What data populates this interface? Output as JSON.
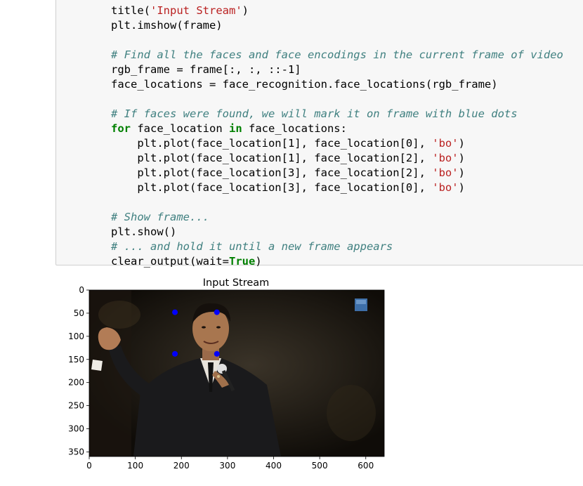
{
  "code_cell": {
    "lines": [
      [
        {
          "t": "title(",
          "c": ""
        },
        {
          "t": "'Input Stream'",
          "c": "st"
        },
        {
          "t": ")",
          "c": ""
        }
      ],
      [
        {
          "t": "plt.imshow(frame)",
          "c": ""
        }
      ],
      [],
      [
        {
          "t": "# Find all the faces and face encodings in the current frame of video",
          "c": "cm"
        }
      ],
      [
        {
          "t": "rgb_frame = frame[:, :, ::-1]",
          "c": ""
        }
      ],
      [
        {
          "t": "face_locations = face_recognition.face_locations(rgb_frame)",
          "c": ""
        }
      ],
      [],
      [
        {
          "t": "# If faces were found, we will mark it on frame with blue dots",
          "c": "cm"
        }
      ],
      [
        {
          "t": "for",
          "c": "kw"
        },
        {
          "t": " face_location ",
          "c": ""
        },
        {
          "t": "in",
          "c": "kw"
        },
        {
          "t": " face_locations:",
          "c": ""
        }
      ],
      [
        {
          "t": "    plt.plot(face_location[1], face_location[0], ",
          "c": ""
        },
        {
          "t": "'bo'",
          "c": "st"
        },
        {
          "t": ")",
          "c": ""
        }
      ],
      [
        {
          "t": "    plt.plot(face_location[1], face_location[2], ",
          "c": ""
        },
        {
          "t": "'bo'",
          "c": "st"
        },
        {
          "t": ")",
          "c": ""
        }
      ],
      [
        {
          "t": "    plt.plot(face_location[3], face_location[2], ",
          "c": ""
        },
        {
          "t": "'bo'",
          "c": "st"
        },
        {
          "t": ")",
          "c": ""
        }
      ],
      [
        {
          "t": "    plt.plot(face_location[3], face_location[0], ",
          "c": ""
        },
        {
          "t": "'bo'",
          "c": "st"
        },
        {
          "t": ")",
          "c": ""
        }
      ],
      [],
      [
        {
          "t": "# Show frame...",
          "c": "cm"
        }
      ],
      [
        {
          "t": "plt.show()",
          "c": ""
        }
      ],
      [
        {
          "t": "# ... and hold it until a new frame appears",
          "c": "cm"
        }
      ],
      [
        {
          "t": "clear_output(wait=",
          "c": ""
        },
        {
          "t": "True",
          "c": "kw"
        },
        {
          "t": ")",
          "c": ""
        }
      ]
    ]
  },
  "chart_data": {
    "type": "scatter",
    "title": "Input Stream",
    "xlabel": "",
    "ylabel": "",
    "xlim": [
      0,
      640
    ],
    "ylim": [
      360,
      0
    ],
    "y_inverted": true,
    "x_ticks": [
      0,
      100,
      200,
      300,
      400,
      500,
      600
    ],
    "y_ticks": [
      0,
      50,
      100,
      150,
      200,
      250,
      300,
      350
    ],
    "marker_color": "#0000ff",
    "points": [
      {
        "x": 186,
        "y": 48
      },
      {
        "x": 277,
        "y": 48
      },
      {
        "x": 186,
        "y": 138
      },
      {
        "x": 277,
        "y": 138
      }
    ],
    "background_image": "video frame: man in dark suit holding a microphone, gesturing with his left hand; small blue network logo in the top-right corner"
  }
}
